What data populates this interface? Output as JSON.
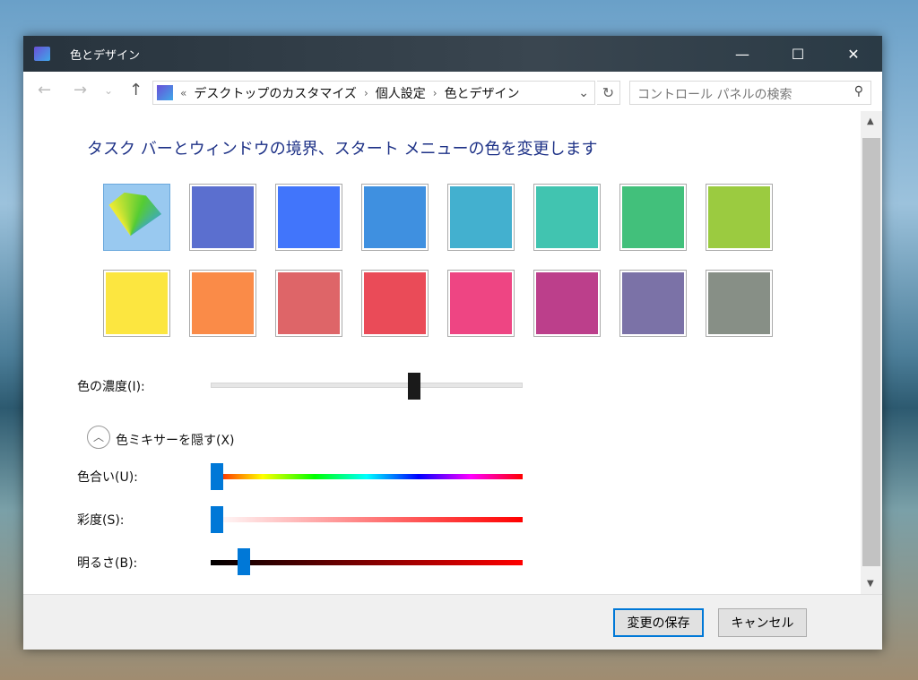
{
  "window": {
    "title": "色とデザイン",
    "minimize": "—",
    "maximize": "☐",
    "close": "✕"
  },
  "toolbar": {
    "back": "←",
    "forward": "→",
    "recent": "⌄",
    "up": "↑",
    "overflow": "«",
    "breadcrumb": [
      "デスクトップのカスタマイズ",
      "個人設定",
      "色とデザイン"
    ],
    "separator": "›",
    "dropdown": "⌄",
    "refresh": "↻",
    "search_placeholder": "コントロール パネルの検索",
    "search_icon": "⚲"
  },
  "heading": "タスク バーとウィンドウの境界、スタート メニューの色を変更します",
  "swatches": [
    "#5b6fcf",
    "#4175fb",
    "#3f90e0",
    "#43b0cf",
    "#41c4b0",
    "#42c07b",
    "#9bcb40",
    "#fce640",
    "#fa8b48",
    "#de6568",
    "#ea4b58",
    "#ee4583",
    "#bc3f8b",
    "#7b72a7",
    "#878f86"
  ],
  "intensity": {
    "label": "色の濃度(I):",
    "value": 0.66
  },
  "mixer_toggle": {
    "label": "色ミキサーを隠す(X)"
  },
  "hue": {
    "label": "色合い(U):",
    "value": 0
  },
  "saturation": {
    "label": "彩度(S):",
    "value": 0
  },
  "brightness": {
    "label": "明るさ(B):",
    "value": 0.09
  },
  "footer": {
    "save": "変更の保存",
    "cancel": "キャンセル"
  }
}
